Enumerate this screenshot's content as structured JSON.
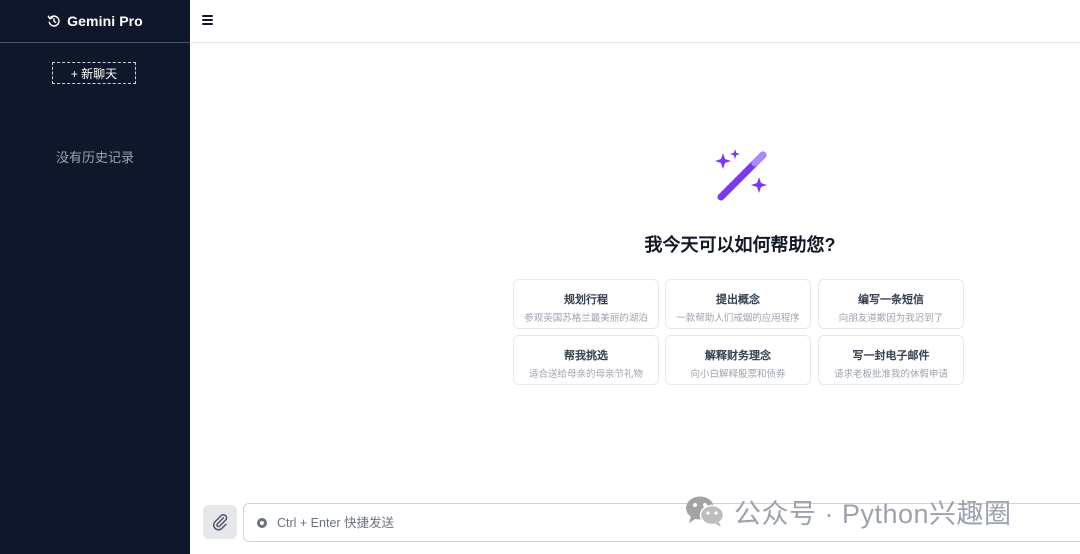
{
  "sidebar": {
    "logo_icon": "history-icon",
    "app_title": "Gemini Pro",
    "new_chat_label": "+ 新聊天",
    "empty_history_text": "没有历史记录"
  },
  "topbar": {
    "menu_icon": "menu-icon"
  },
  "main": {
    "hero_icon": "magic-wand-icon",
    "accent_color": "#7c3aed",
    "headline": "我今天可以如何帮助您?",
    "suggestions": [
      {
        "title": "规划行程",
        "subtitle": "参观英国苏格兰最美丽的湖泊"
      },
      {
        "title": "提出概念",
        "subtitle": "一款帮助人们戒烟的应用程序"
      },
      {
        "title": "编写一条短信",
        "subtitle": "向朋友道歉因为我迟到了"
      },
      {
        "title": "帮我挑选",
        "subtitle": "适合送给母亲的母亲节礼物"
      },
      {
        "title": "解释财务理念",
        "subtitle": "向小白解释股票和债券"
      },
      {
        "title": "写一封电子邮件",
        "subtitle": "请求老板批准我的休假申请"
      }
    ]
  },
  "composer": {
    "attach_icon": "paperclip-icon",
    "placeholder": "Ctrl + Enter 快捷发送"
  },
  "watermark": {
    "text": "公众号 · Python兴趣圈",
    "icon": "wechat-icon"
  }
}
